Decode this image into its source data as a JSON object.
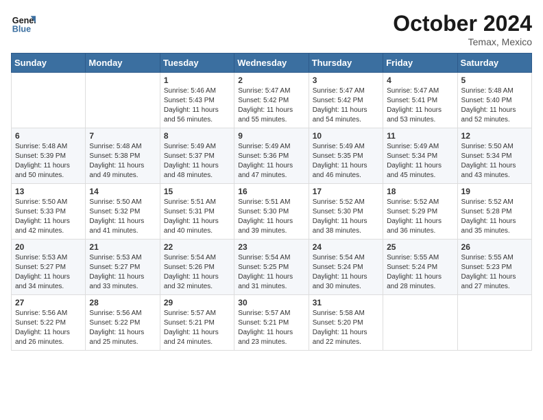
{
  "header": {
    "logo_line1": "General",
    "logo_line2": "Blue",
    "month": "October 2024",
    "location": "Temax, Mexico"
  },
  "weekdays": [
    "Sunday",
    "Monday",
    "Tuesday",
    "Wednesday",
    "Thursday",
    "Friday",
    "Saturday"
  ],
  "weeks": [
    [
      {
        "day": "",
        "info": ""
      },
      {
        "day": "",
        "info": ""
      },
      {
        "day": "1",
        "info": "Sunrise: 5:46 AM\nSunset: 5:43 PM\nDaylight: 11 hours and 56 minutes."
      },
      {
        "day": "2",
        "info": "Sunrise: 5:47 AM\nSunset: 5:42 PM\nDaylight: 11 hours and 55 minutes."
      },
      {
        "day": "3",
        "info": "Sunrise: 5:47 AM\nSunset: 5:42 PM\nDaylight: 11 hours and 54 minutes."
      },
      {
        "day": "4",
        "info": "Sunrise: 5:47 AM\nSunset: 5:41 PM\nDaylight: 11 hours and 53 minutes."
      },
      {
        "day": "5",
        "info": "Sunrise: 5:48 AM\nSunset: 5:40 PM\nDaylight: 11 hours and 52 minutes."
      }
    ],
    [
      {
        "day": "6",
        "info": "Sunrise: 5:48 AM\nSunset: 5:39 PM\nDaylight: 11 hours and 50 minutes."
      },
      {
        "day": "7",
        "info": "Sunrise: 5:48 AM\nSunset: 5:38 PM\nDaylight: 11 hours and 49 minutes."
      },
      {
        "day": "8",
        "info": "Sunrise: 5:49 AM\nSunset: 5:37 PM\nDaylight: 11 hours and 48 minutes."
      },
      {
        "day": "9",
        "info": "Sunrise: 5:49 AM\nSunset: 5:36 PM\nDaylight: 11 hours and 47 minutes."
      },
      {
        "day": "10",
        "info": "Sunrise: 5:49 AM\nSunset: 5:35 PM\nDaylight: 11 hours and 46 minutes."
      },
      {
        "day": "11",
        "info": "Sunrise: 5:49 AM\nSunset: 5:34 PM\nDaylight: 11 hours and 45 minutes."
      },
      {
        "day": "12",
        "info": "Sunrise: 5:50 AM\nSunset: 5:34 PM\nDaylight: 11 hours and 43 minutes."
      }
    ],
    [
      {
        "day": "13",
        "info": "Sunrise: 5:50 AM\nSunset: 5:33 PM\nDaylight: 11 hours and 42 minutes."
      },
      {
        "day": "14",
        "info": "Sunrise: 5:50 AM\nSunset: 5:32 PM\nDaylight: 11 hours and 41 minutes."
      },
      {
        "day": "15",
        "info": "Sunrise: 5:51 AM\nSunset: 5:31 PM\nDaylight: 11 hours and 40 minutes."
      },
      {
        "day": "16",
        "info": "Sunrise: 5:51 AM\nSunset: 5:30 PM\nDaylight: 11 hours and 39 minutes."
      },
      {
        "day": "17",
        "info": "Sunrise: 5:52 AM\nSunset: 5:30 PM\nDaylight: 11 hours and 38 minutes."
      },
      {
        "day": "18",
        "info": "Sunrise: 5:52 AM\nSunset: 5:29 PM\nDaylight: 11 hours and 36 minutes."
      },
      {
        "day": "19",
        "info": "Sunrise: 5:52 AM\nSunset: 5:28 PM\nDaylight: 11 hours and 35 minutes."
      }
    ],
    [
      {
        "day": "20",
        "info": "Sunrise: 5:53 AM\nSunset: 5:27 PM\nDaylight: 11 hours and 34 minutes."
      },
      {
        "day": "21",
        "info": "Sunrise: 5:53 AM\nSunset: 5:27 PM\nDaylight: 11 hours and 33 minutes."
      },
      {
        "day": "22",
        "info": "Sunrise: 5:54 AM\nSunset: 5:26 PM\nDaylight: 11 hours and 32 minutes."
      },
      {
        "day": "23",
        "info": "Sunrise: 5:54 AM\nSunset: 5:25 PM\nDaylight: 11 hours and 31 minutes."
      },
      {
        "day": "24",
        "info": "Sunrise: 5:54 AM\nSunset: 5:24 PM\nDaylight: 11 hours and 30 minutes."
      },
      {
        "day": "25",
        "info": "Sunrise: 5:55 AM\nSunset: 5:24 PM\nDaylight: 11 hours and 28 minutes."
      },
      {
        "day": "26",
        "info": "Sunrise: 5:55 AM\nSunset: 5:23 PM\nDaylight: 11 hours and 27 minutes."
      }
    ],
    [
      {
        "day": "27",
        "info": "Sunrise: 5:56 AM\nSunset: 5:22 PM\nDaylight: 11 hours and 26 minutes."
      },
      {
        "day": "28",
        "info": "Sunrise: 5:56 AM\nSunset: 5:22 PM\nDaylight: 11 hours and 25 minutes."
      },
      {
        "day": "29",
        "info": "Sunrise: 5:57 AM\nSunset: 5:21 PM\nDaylight: 11 hours and 24 minutes."
      },
      {
        "day": "30",
        "info": "Sunrise: 5:57 AM\nSunset: 5:21 PM\nDaylight: 11 hours and 23 minutes."
      },
      {
        "day": "31",
        "info": "Sunrise: 5:58 AM\nSunset: 5:20 PM\nDaylight: 11 hours and 22 minutes."
      },
      {
        "day": "",
        "info": ""
      },
      {
        "day": "",
        "info": ""
      }
    ]
  ]
}
